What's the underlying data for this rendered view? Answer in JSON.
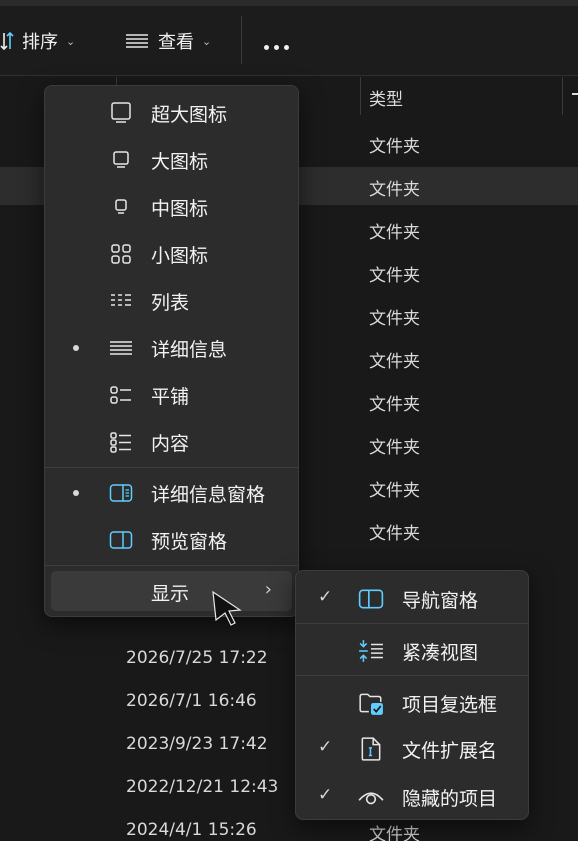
{
  "toolbar": {
    "sort_label": "排序",
    "view_label": "查看",
    "more_label": "更多选项"
  },
  "columns": {
    "type_header": "类型"
  },
  "file_types": [
    "文件夹",
    "文件夹",
    "文件夹",
    "文件夹",
    "文件夹",
    "文件夹",
    "文件夹",
    "文件夹",
    "文件夹",
    "文件夹",
    "文件夹"
  ],
  "dates": [
    "2026/7/25 17:22",
    "2026/7/1 16:46",
    "2023/9/23 17:42",
    "2022/12/21 12:43",
    "2024/4/1 15:26"
  ],
  "view_menu": {
    "items": [
      {
        "label": "超大图标",
        "icon": "extra-large-icons-icon",
        "selected": false
      },
      {
        "label": "大图标",
        "icon": "large-icons-icon",
        "selected": false
      },
      {
        "label": "中图标",
        "icon": "medium-icons-icon",
        "selected": false
      },
      {
        "label": "小图标",
        "icon": "small-icons-icon",
        "selected": false
      },
      {
        "label": "列表",
        "icon": "list-icon",
        "selected": false
      },
      {
        "label": "详细信息",
        "icon": "details-icon",
        "selected": true
      },
      {
        "label": "平铺",
        "icon": "tiles-icon",
        "selected": false
      },
      {
        "label": "内容",
        "icon": "content-icon",
        "selected": false
      },
      {
        "label": "详细信息窗格",
        "icon": "details-pane-icon",
        "selected": true
      },
      {
        "label": "预览窗格",
        "icon": "preview-pane-icon",
        "selected": false
      }
    ],
    "show_label": "显示"
  },
  "show_submenu": {
    "items": [
      {
        "label": "导航窗格",
        "icon": "navigation-pane-icon",
        "checked": true
      },
      {
        "label": "紧凑视图",
        "icon": "compact-view-icon",
        "checked": false
      },
      {
        "label": "项目复选框",
        "icon": "item-checkbox-icon",
        "checked": false
      },
      {
        "label": "文件扩展名",
        "icon": "file-extension-icon",
        "checked": true
      },
      {
        "label": "隐藏的项目",
        "icon": "hidden-items-icon",
        "checked": true
      }
    ]
  },
  "colors": {
    "accent": "#60cdff",
    "menu_bg": "#2c2c2c",
    "window_bg": "#191919"
  }
}
